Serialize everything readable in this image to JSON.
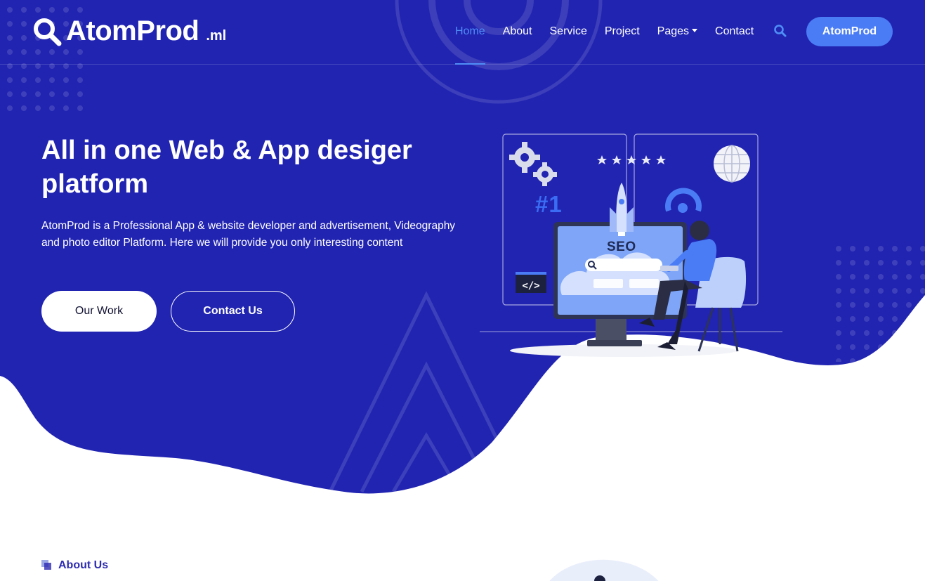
{
  "brand": {
    "name": "AtomProd",
    "suffix": ".ml"
  },
  "nav": {
    "items": [
      {
        "label": "Home",
        "active": true
      },
      {
        "label": "About",
        "active": false
      },
      {
        "label": "Service",
        "active": false
      },
      {
        "label": "Project",
        "active": false
      },
      {
        "label": "Pages",
        "active": false,
        "dropdown": true
      },
      {
        "label": "Contact",
        "active": false
      }
    ],
    "search_icon": "search-icon",
    "cta_label": "AtomProd"
  },
  "hero": {
    "title": "All in one Web & App desiger platform",
    "description": "AtomProd is a Professional App & website developer and advertisement, Videography and photo editor Platform. Here we will provide you only interesting content",
    "primary_button": "Our Work",
    "secondary_button": "Contact Us",
    "illustration": {
      "rank_text": "#1",
      "seo_text": "SEO"
    }
  },
  "about": {
    "tag": "About Us"
  },
  "colors": {
    "hero_background": "#2124b1",
    "accent": "#4a7cf6",
    "nav_active": "#4f8ef7",
    "white": "#ffffff"
  }
}
